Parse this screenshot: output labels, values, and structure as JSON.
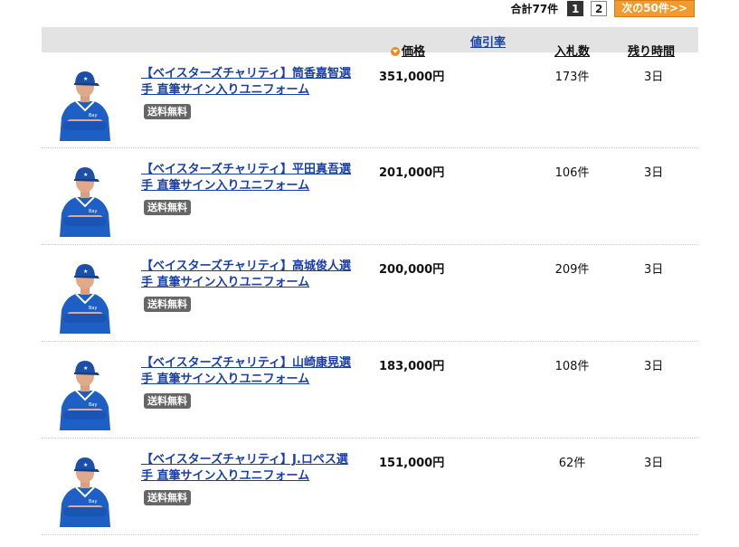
{
  "pagination": {
    "total": "合計77件",
    "pages": [
      "1",
      "2"
    ],
    "next": "次の50件>>"
  },
  "header": {
    "price": "価格",
    "discount": "値引率",
    "bids": "入札数",
    "time": "残り時間"
  },
  "colors": {
    "link": "#1a3ea8",
    "accent": "#f29a2e",
    "header_bg": "#e3e3e3"
  },
  "items": [
    {
      "title": "【ベイスターズチャリティ】筒香嘉智選手 直筆サイン入りユニフォーム",
      "badge": "送料無料",
      "price": "351,000円",
      "bids": "173件",
      "time": "3日"
    },
    {
      "title": "【ベイスターズチャリティ】平田真吾選手 直筆サイン入りユニフォーム",
      "badge": "送料無料",
      "price": "201,000円",
      "bids": "106件",
      "time": "3日"
    },
    {
      "title": "【ベイスターズチャリティ】高城俊人選手 直筆サイン入りユニフォーム",
      "badge": "送料無料",
      "price": "200,000円",
      "bids": "209件",
      "time": "3日"
    },
    {
      "title": "【ベイスターズチャリティ】山崎康晃選手 直筆サイン入りユニフォーム",
      "badge": "送料無料",
      "price": "183,000円",
      "bids": "108件",
      "time": "3日"
    },
    {
      "title": "【ベイスターズチャリティ】J.ロペス選手 直筆サイン入りユニフォーム",
      "badge": "送料無料",
      "price": "151,000円",
      "bids": "62件",
      "time": "3日"
    }
  ]
}
